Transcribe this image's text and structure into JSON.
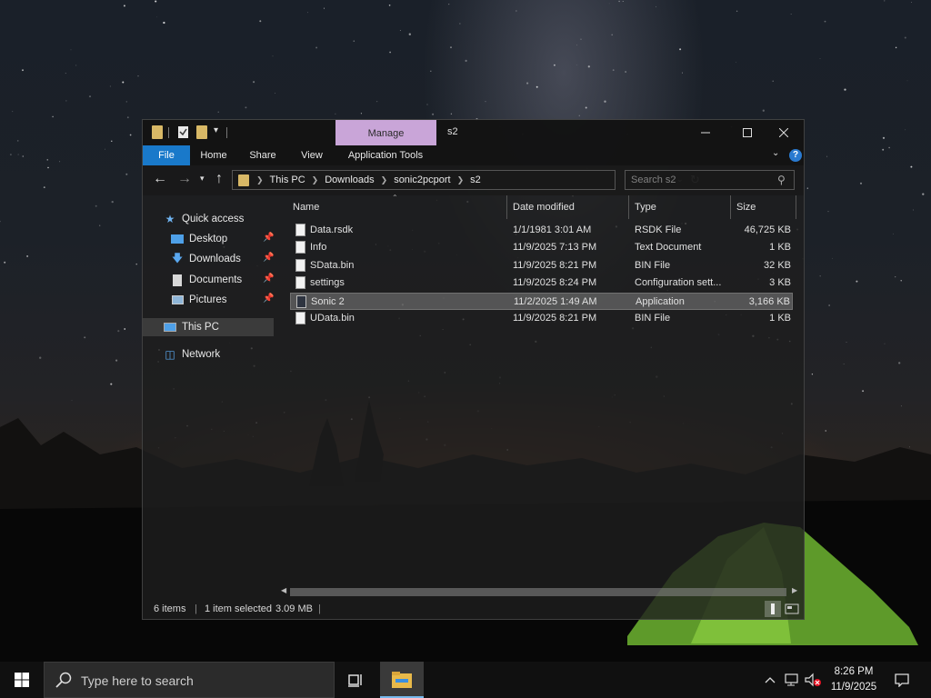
{
  "window": {
    "title": "s2",
    "contextual_tab": "Manage",
    "ribbon_tabs": [
      "File",
      "Home",
      "Share",
      "View",
      "Application Tools"
    ],
    "help_label": "?"
  },
  "address": {
    "crumbs": [
      "This PC",
      "Downloads",
      "sonic2pcport",
      "s2"
    ],
    "search_placeholder": "Search s2"
  },
  "nav_pane": {
    "quick_access": "Quick access",
    "items": [
      "Desktop",
      "Downloads",
      "Documents",
      "Pictures"
    ],
    "this_pc": "This PC",
    "network": "Network"
  },
  "columns": [
    "Name",
    "Date modified",
    "Type",
    "Size"
  ],
  "files": [
    {
      "name": "Data.rsdk",
      "date": "1/1/1981 3:01 AM",
      "type": "RSDK File",
      "size": "46,725 KB",
      "selected": false
    },
    {
      "name": "Info",
      "date": "11/9/2025 7:13 PM",
      "type": "Text Document",
      "size": "1 KB",
      "selected": false
    },
    {
      "name": "SData.bin",
      "date": "11/9/2025 8:21 PM",
      "type": "BIN File",
      "size": "32 KB",
      "selected": false
    },
    {
      "name": "settings",
      "date": "11/9/2025 8:24 PM",
      "type": "Configuration sett...",
      "size": "3 KB",
      "selected": false
    },
    {
      "name": "Sonic 2",
      "date": "11/2/2025 1:49 AM",
      "type": "Application",
      "size": "3,166 KB",
      "selected": true
    },
    {
      "name": "UData.bin",
      "date": "11/9/2025 8:21 PM",
      "type": "BIN File",
      "size": "1 KB",
      "selected": false
    }
  ],
  "status": {
    "item_count": "6 items",
    "selection": "1 item selected",
    "selection_size": "3.09 MB"
  },
  "taskbar": {
    "search_placeholder": "Type here to search",
    "time": "8:26 PM",
    "date": "11/9/2025"
  },
  "colors": {
    "accent": "#1979ca",
    "manage_tab": "#c9a5d8",
    "folder": "#d8b866"
  }
}
